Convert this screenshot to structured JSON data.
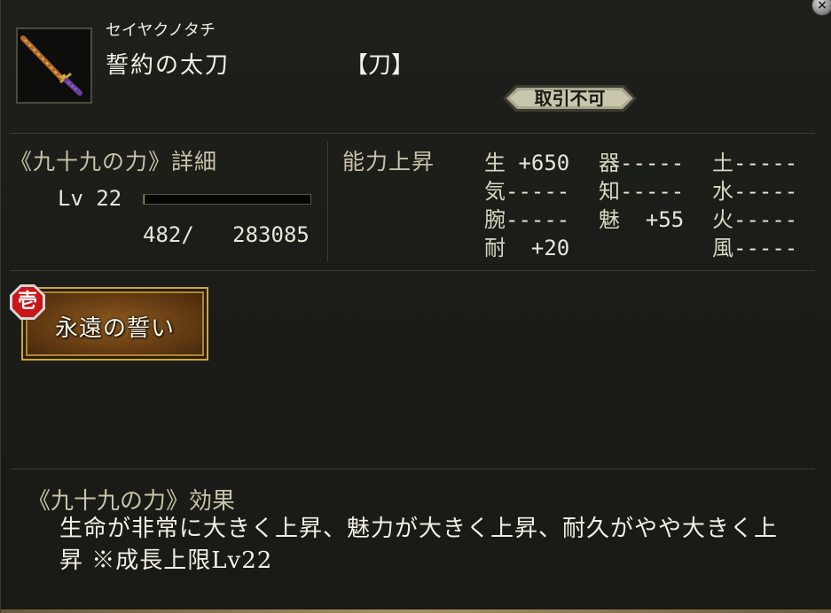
{
  "window": {
    "close_glyph": "×"
  },
  "item": {
    "reading": "セイヤクノタチ",
    "name": "誓約の太刀",
    "type": "【刀】",
    "trade_status": "取引不可",
    "icon": "katana-icon"
  },
  "detail": {
    "title": "《九十九の力》詳細",
    "level_label": "Lv 22",
    "exp_current": "482/",
    "exp_total": "283085",
    "exp_fraction": 0.0017
  },
  "stats": {
    "title": "能力上昇",
    "col1": [
      {
        "k": "生",
        "v": " +650"
      },
      {
        "k": "気",
        "v": "-----"
      },
      {
        "k": "腕",
        "v": "-----"
      },
      {
        "k": "耐",
        "v": "  +20"
      }
    ],
    "col2": [
      {
        "k": "器",
        "v": "-----"
      },
      {
        "k": "知",
        "v": "-----"
      },
      {
        "k": "魅",
        "v": "  +55"
      }
    ],
    "col3": [
      {
        "k": "土",
        "v": "-----"
      },
      {
        "k": "水",
        "v": "-----"
      },
      {
        "k": "火",
        "v": "-----"
      },
      {
        "k": "風",
        "v": "-----"
      }
    ]
  },
  "skill": {
    "number": "壱",
    "label": "永遠の誓い"
  },
  "effect": {
    "title": "《九十九の力》効果",
    "text": "生命が非常に大きく上昇、魅力が大きく上昇、耐久がやや大きく上昇 ※成長上限Lv22"
  }
}
